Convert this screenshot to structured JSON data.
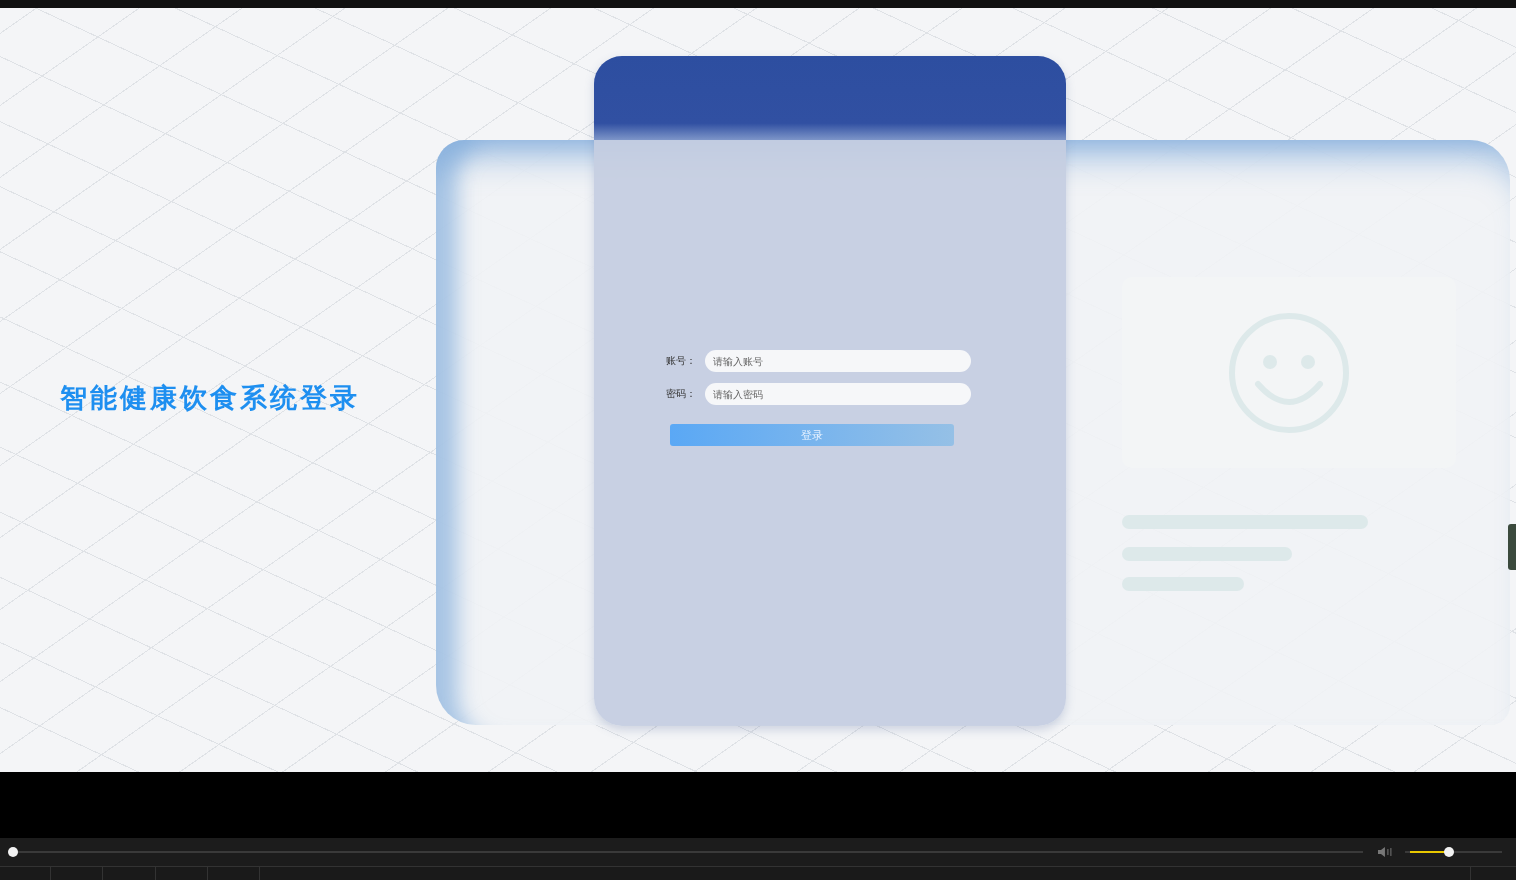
{
  "page": {
    "title": "智能健康饮食系统登录",
    "form": {
      "fields": [
        {
          "label": "账号：",
          "placeholder": "请输入账号"
        },
        {
          "label": "密码：",
          "placeholder": "请输入密码"
        }
      ],
      "submit": "登录"
    }
  },
  "player": {
    "seek": {
      "level": 0
    },
    "volume": {
      "level": 0.45
    }
  }
}
